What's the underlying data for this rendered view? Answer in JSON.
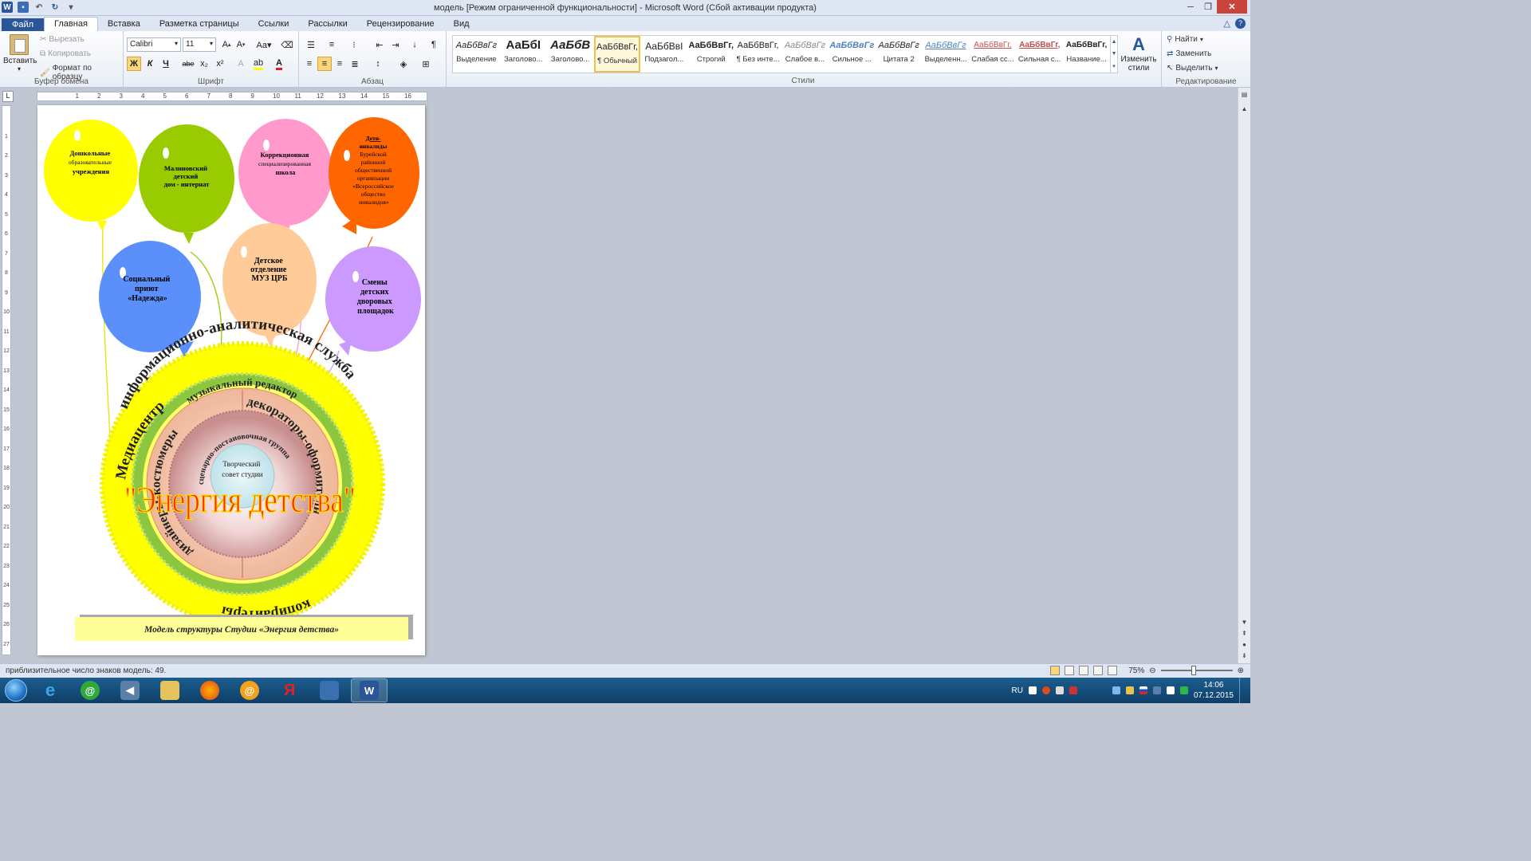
{
  "window": {
    "title": "модель [Режим ограниченной функциональности]  -  Microsoft Word (Сбой активации продукта)"
  },
  "tabs": [
    {
      "label": "Файл"
    },
    {
      "label": "Главная"
    },
    {
      "label": "Вставка"
    },
    {
      "label": "Разметка страницы"
    },
    {
      "label": "Ссылки"
    },
    {
      "label": "Рассылки"
    },
    {
      "label": "Рецензирование"
    },
    {
      "label": "Вид"
    }
  ],
  "clipboard": {
    "paste": "Вставить",
    "cut": "Вырезать",
    "copy": "Копировать",
    "format_painter": "Формат по образцу",
    "label": "Буфер обмена"
  },
  "font": {
    "name": "Calibri",
    "size": "11",
    "label": "Шрифт",
    "bold": "Ж",
    "italic": "К",
    "underline": "Ч",
    "strike": "abe",
    "sub": "x₂",
    "sup": "x²"
  },
  "paragraph": {
    "label": "Абзац"
  },
  "styles": {
    "label": "Стили",
    "items": [
      {
        "sample": "АаБбВвГг",
        "name": "Выделение"
      },
      {
        "sample": "АаБбІ",
        "name": "Заголово..."
      },
      {
        "sample": "АаБбВ",
        "name": "Заголово..."
      },
      {
        "sample": "АаБбВвГг,",
        "name": "¶ Обычный"
      },
      {
        "sample": "АаБбВвІ",
        "name": "Подзагол..."
      },
      {
        "sample": "АаБбВвГг,",
        "name": "Строгий"
      },
      {
        "sample": "АаБбВвГг,",
        "name": "¶ Без инте..."
      },
      {
        "sample": "АаБбВвГг",
        "name": "Слабое в..."
      },
      {
        "sample": "АаБбВвГг",
        "name": "Сильное ..."
      },
      {
        "sample": "АаБбВвГг",
        "name": "Цитата 2"
      },
      {
        "sample": "АаБбВвГг",
        "name": "Выделенн..."
      },
      {
        "sample": "АаБбВвГг,",
        "name": "Слабая сс..."
      },
      {
        "sample": "АаБбВвГг,",
        "name": "Сильная с..."
      },
      {
        "sample": "АаБбВвГг,",
        "name": "Название..."
      }
    ],
    "change_styles": "Изменить стили"
  },
  "editing": {
    "label": "Редактирование",
    "find": "Найти",
    "replace": "Заменить",
    "select": "Выделить"
  },
  "document": {
    "balloons": [
      {
        "lines": [
          "Дошкольные",
          "образовательные",
          "учреждения"
        ],
        "color": "#ffff00"
      },
      {
        "lines": [
          "Малиновский",
          "детский",
          "дом - интернат"
        ],
        "color": "#99cc00"
      },
      {
        "lines": [
          "Коррекционная",
          "специализированная",
          "школа"
        ],
        "color": "#ff99cc"
      },
      {
        "lines": [
          "Дети-",
          "инвалиды",
          "Бурейской",
          "районной",
          "общественной",
          "организации",
          "«Всероссийское",
          "общество",
          "инвалидов»"
        ],
        "color": "#ff6600"
      },
      {
        "lines": [
          "Социальный",
          "приют",
          "«Надежда»"
        ],
        "color": "#5b8ff9"
      },
      {
        "lines": [
          "Детское",
          "отделение",
          "МУЗ ЦРБ"
        ],
        "color": "#ffcc99"
      },
      {
        "lines": [
          "Смены",
          "детских",
          "дворовых",
          "площадок"
        ],
        "color": "#cc99ff"
      }
    ],
    "rings": {
      "outer_top": "информационно-аналитическая служба",
      "outer_left": "Медиацентр",
      "outer_bottom": "копирайтеры",
      "ring2_top": "музыкальный редактор",
      "ring3_left": "дизайнеры-костюмеры",
      "ring3_right": "декораторы-оформители",
      "inner_top": "сценарно-постановочная группа",
      "center": [
        "Творческий",
        "совет студии"
      ]
    },
    "big_title": "\"Энергия детства\"",
    "caption": "Модель структуры Студии «Энергия детства»"
  },
  "status": {
    "left": "приблизительное число знаков модель: 49.",
    "zoom": "75%"
  },
  "taskbar": {
    "lang": "RU",
    "time": "14:06",
    "date": "07.12.2015"
  }
}
